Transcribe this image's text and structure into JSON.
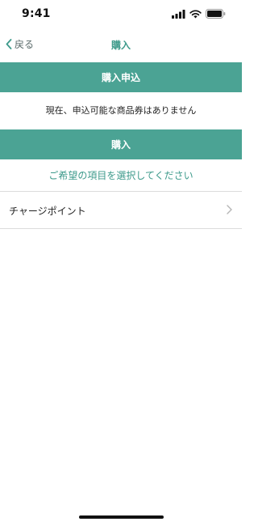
{
  "status_bar": {
    "time": "9:41"
  },
  "nav": {
    "back_label": "戻る",
    "title": "購入"
  },
  "purchase_application": {
    "header": "購入申込",
    "notice": "現在、申込可能な商品券はありません"
  },
  "purchase": {
    "header": "購入",
    "prompt": "ご希望の項目を選択してください",
    "items": [
      {
        "label": "チャージポイント",
        "icon": "chevron-right-icon"
      }
    ]
  },
  "colors": {
    "accent": "#4ba394",
    "accent_text": "#3d9a8b",
    "divider": "#dcdcdc"
  }
}
